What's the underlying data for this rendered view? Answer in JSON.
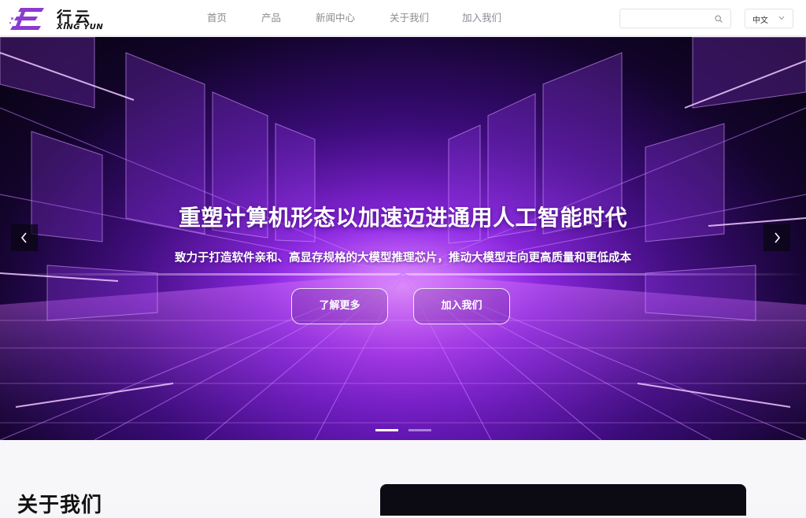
{
  "header": {
    "logo_cn": "行云",
    "logo_en": "XING YUN",
    "nav": [
      "首页",
      "产品",
      "新闻中心",
      "关于我们",
      "加入我们"
    ],
    "search_placeholder": "",
    "search_icon": "search-icon",
    "language": "中文",
    "language_icon": "chevron-down-icon"
  },
  "hero": {
    "title": "重塑计算机形态以加速迈进通用人工智能时代",
    "subtitle": "致力于打造软件亲和、高显存规格的大模型推理芯片，推动大模型走向更高质量和更低成本",
    "learn_more": "了解更多",
    "join_us": "加入我们",
    "prev_icon": "chevron-left-icon",
    "next_icon": "chevron-right-icon",
    "slides_total": 2,
    "active_slide": 1
  },
  "about": {
    "title": "关于我们"
  },
  "colors": {
    "brand": "#8a3ccf",
    "accent": "#b44bff",
    "header_bg": "#ffffff"
  }
}
